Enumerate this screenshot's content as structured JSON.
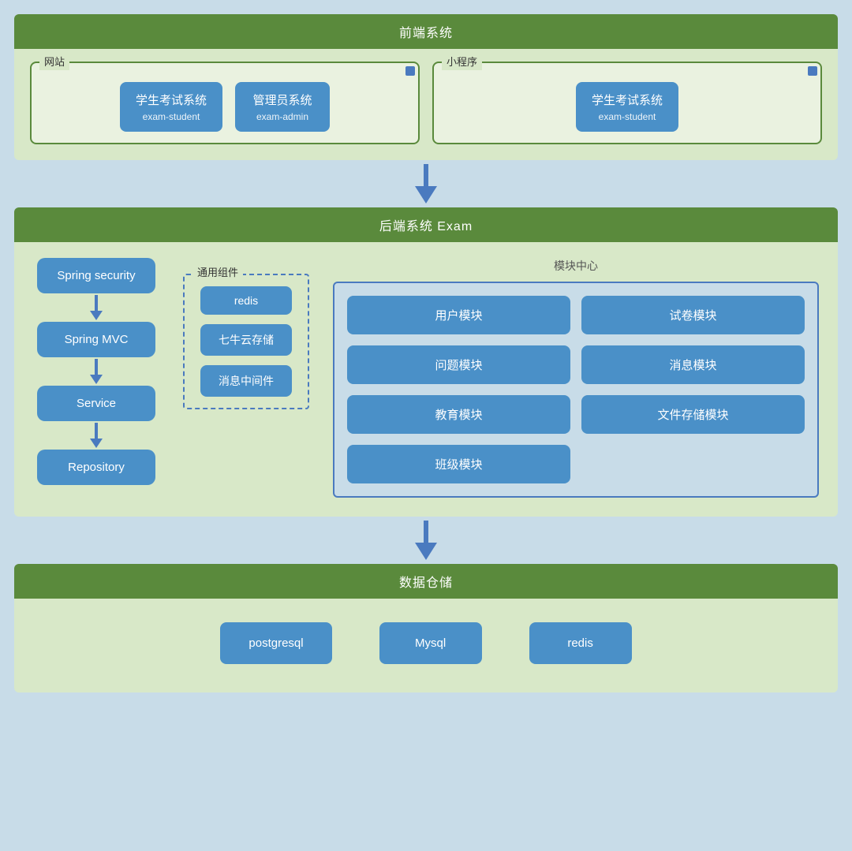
{
  "frontend": {
    "header": "前端系统",
    "website": {
      "label": "网站",
      "systems": [
        {
          "name": "学生考试系统",
          "sub": "exam-student"
        },
        {
          "name": "管理员系统",
          "sub": "exam-admin"
        }
      ]
    },
    "miniapp": {
      "label": "小程序",
      "systems": [
        {
          "name": "学生考试系统",
          "sub": "exam-student"
        }
      ]
    }
  },
  "backend": {
    "header": "后端系统 Exam",
    "flow": [
      "Spring security",
      "Spring MVC",
      "Service",
      "Repository"
    ],
    "common": {
      "label": "通用组件",
      "items": [
        "redis",
        "七牛云存储",
        "消息中间件"
      ]
    },
    "modules": {
      "label": "模块中心",
      "items": [
        "用户模块",
        "试卷模块",
        "问题模块",
        "消息模块",
        "教育模块",
        "文件存储模块",
        "班级模块"
      ]
    }
  },
  "database": {
    "header": "数据仓储",
    "items": [
      "postgresql",
      "Mysql",
      "redis"
    ]
  }
}
